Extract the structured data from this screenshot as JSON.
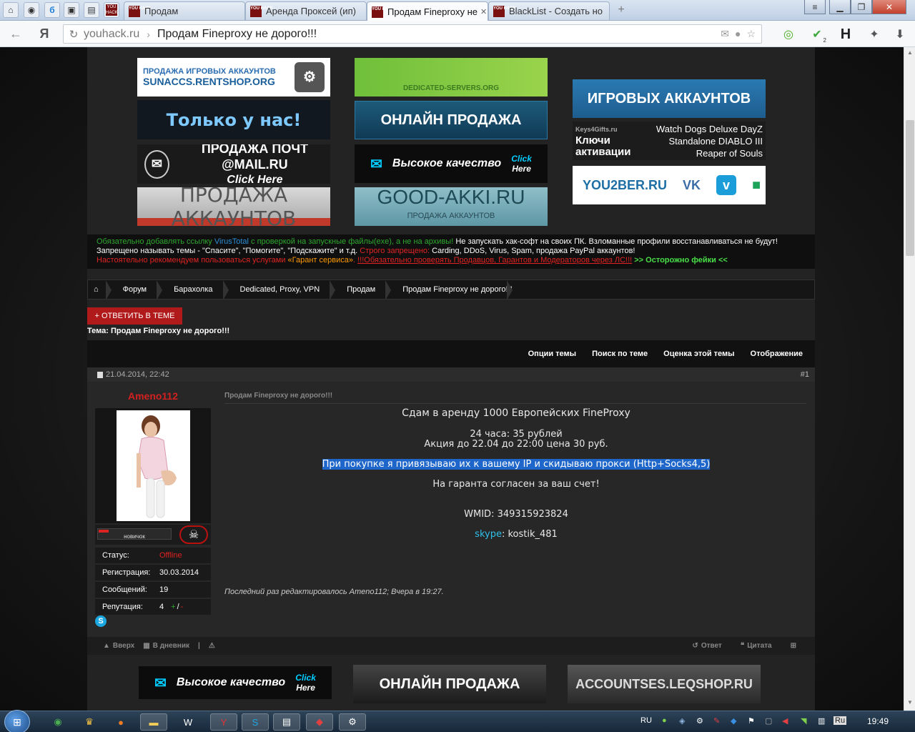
{
  "browser": {
    "tabs": [
      {
        "label": "Продам",
        "favicon": "YOU HACK"
      },
      {
        "label": "Аренда Проксей (ип)",
        "favicon": "YOU HACK"
      },
      {
        "label": "Продам Fineproxy не",
        "favicon": "YOU HACK"
      },
      {
        "label": "BlackList - Создать но",
        "favicon": "YOU HACK"
      }
    ],
    "url_domain": "youhack.ru",
    "url_separator": "›",
    "url_title": "Продам Fineproxy не дорого!!!",
    "yandex_label": "Я",
    "ext_badge": "2",
    "ext_h": "H"
  },
  "banners": {
    "steam_line1": "ПРОДАЖА ИГРОВЫХ АККАУНТОВ",
    "steam_line2": "SUNACCS.RENTSHOP.ORG",
    "only_us": "Только у нас!",
    "mail_line1": "ПРОДАЖА ПОЧТ @MAIL.RU",
    "mail_line2": "Click Here",
    "accounts_sale": "ПРОДАЖА АККАУНТОВ",
    "green_banner": "DEDICATED-SERVERS.ORG",
    "online_sale": "ОНЛАЙН ПРОДАЖА",
    "quality": "Высокое качество",
    "click": "Click",
    "here": "Here",
    "good_akki": "GOOD-AKKI.RU",
    "good_akki_sub": "ПРОДАЖА АККАУНТОВ",
    "game_accounts": "ИГРОВЫХ АККАУНТОВ",
    "keys_brand": "Keys4Gifts.ru",
    "keys_title": "Ключи активации",
    "keys_games": "Watch Dogs Deluxe DayZ Standalone DIABLO III Reaper of Souls",
    "you2ber": "YOU2BER.RU",
    "vk": "VK",
    "leqshop": "ACCOUNTSES.LEQSHOP.RU"
  },
  "rules": {
    "line1_a": "Обязательно добавлять ссылку ",
    "line1_b": "VirusTotal",
    "line1_c": " с проверкой на запускные файлы(exe), а не на архивы!",
    "line1_d": " Не запускать хак-софт на своих ПК. Взломанные профили восстанавливаться не будут!",
    "line2_a": "Запрещено называть темы - \"Спасите\", \"Помогите\", \"Подскажите\" и т.д. ",
    "line2_b": "Строго запрещено:",
    "line2_c": " Carding, DDoS, Virus, Spam, продажа PayPal аккаунтов!",
    "line3_a": "Настоятельно рекомендуем пользоваться услугами ",
    "line3_b": "«Гарант сервиса»",
    "line3_c": ". ",
    "line3_d": "!!!Обязательно проверять Продавцов, Гарантов и Модераторов через ЛС!!!",
    "line3_e": " >> Осторожно фейки <<"
  },
  "breadcrumb": [
    "Форум",
    "Барахолка",
    "Dedicated, Proxy, VPN",
    "Продам",
    "Продам Fineproxy не дорого!!!"
  ],
  "reply_button": "+ ОТВЕТИТЬ В ТЕМЕ",
  "thread": {
    "label": "Тема:",
    "title": "Продам Fineproxy не дорого!!!"
  },
  "toolbar": [
    "Опции темы",
    "Поиск по теме",
    "Оценка этой темы",
    "Отображение"
  ],
  "post": {
    "date": "21.04.2014, 22:42",
    "number": "#1",
    "username": "Ameno112",
    "rank": "новичок",
    "rank_progress": 0.14,
    "status_label": "Статус:",
    "status_value": "Offline",
    "reg_label": "Регистрация:",
    "reg_value": "30.03.2014",
    "msgs_label": "Сообщений:",
    "msgs_value": "19",
    "rep_label": "Репутация:",
    "rep_value": "4",
    "rep_plus": "+",
    "rep_slash": "/",
    "rep_minus": "-",
    "subject": "Продам Fineproxy не дорого!!!",
    "line1": "Сдам в аренду 1000 Европейских FineProxy",
    "line2": "24 часа: 35 рублей",
    "line3": "Акция до 22.04 до 22:00 цена 30 руб.",
    "line4": "При покупке я привязываю их к вашему IP и скидываю прокси (Http+Socks4,5)",
    "line5": "На гаранта согласен за ваш счет!",
    "line6": "WMID: 349315923824",
    "skype_label": "skype",
    "skype_value": ": kostik_481",
    "edit_note": "Последний раз редактировалось Ameno112; Вчера в 19:27."
  },
  "post_footer": {
    "up": "Вверх",
    "diary": "В дневник",
    "reply": "Ответ",
    "quote": "Цитата"
  },
  "taskbar": {
    "lang": "RU",
    "lang2": "Ru",
    "clock": "19:49"
  }
}
